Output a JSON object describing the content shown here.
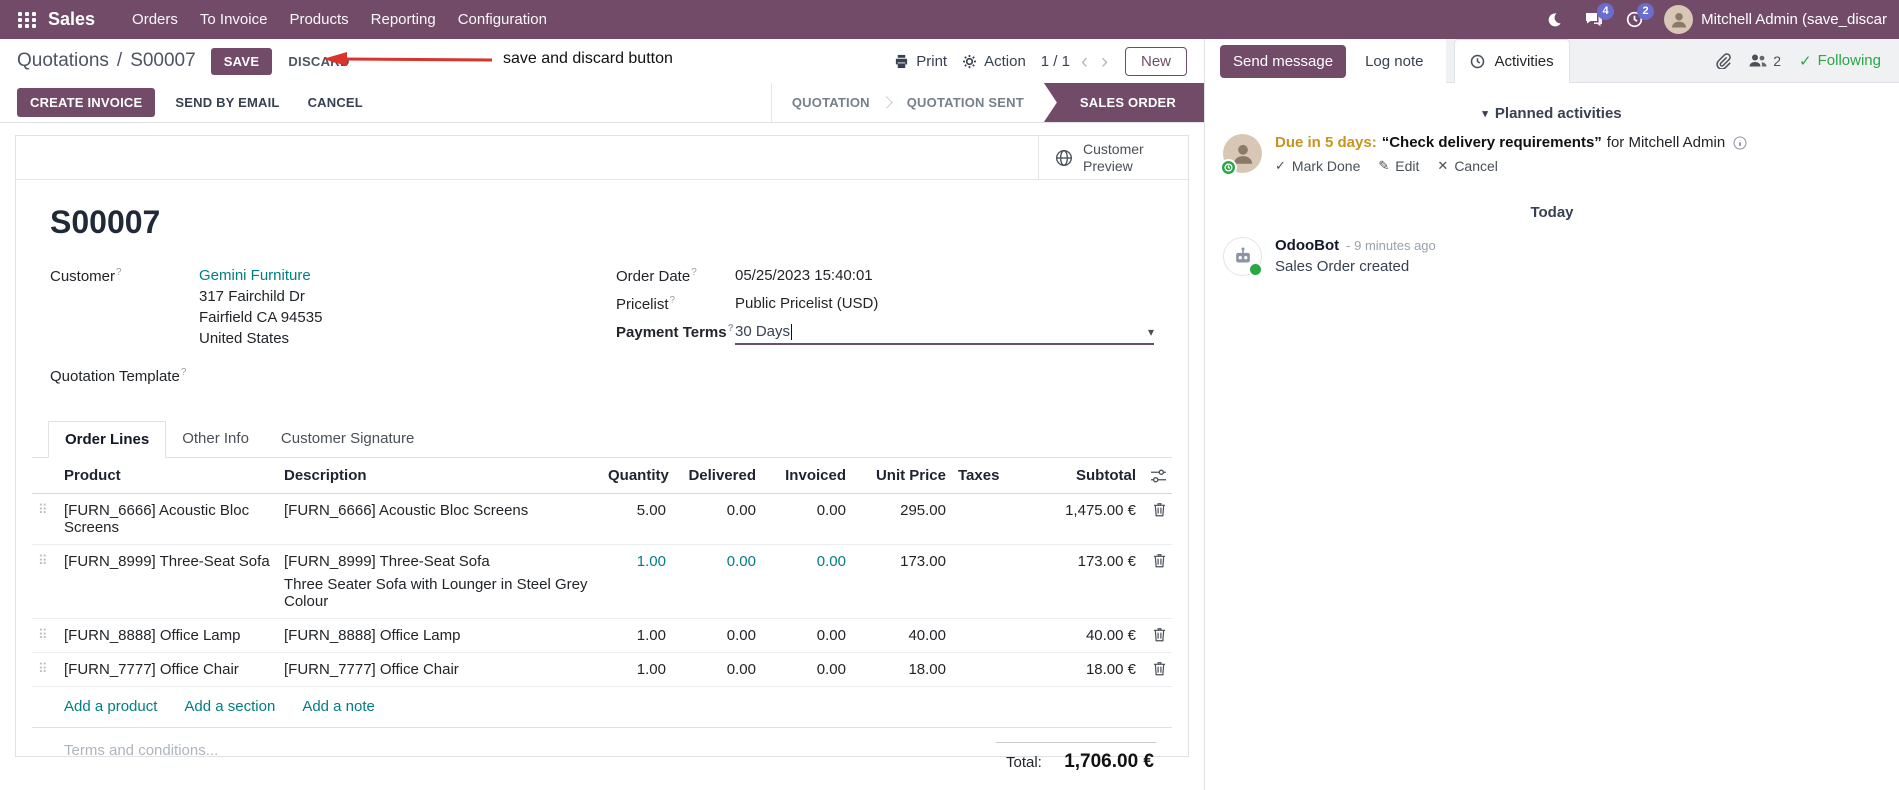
{
  "colors": {
    "primary": "#714B67",
    "link": "#017E84",
    "badge": "#6A6DCD",
    "annotation_arrow": "#D9342B",
    "activity_due": "#C7941F",
    "following_green": "#28a745"
  },
  "icons": {
    "help": "?",
    "drag_handle": "⠿",
    "dropdown_caret": "▾",
    "collapse_caret": "▾",
    "chevron_prev": "‹",
    "chevron_next": "›",
    "check": "✓",
    "pencil": "✎",
    "cross": "✕",
    "breadcrumb_sep": "/"
  },
  "nav": {
    "app": "Sales",
    "menus": [
      "Orders",
      "To Invoice",
      "Products",
      "Reporting",
      "Configuration"
    ],
    "badges": {
      "messages": "4",
      "activities": "2"
    },
    "user": "Mitchell Admin (save_discar"
  },
  "control": {
    "breadcrumb_parent": "Quotations",
    "breadcrumb_current": "S00007",
    "save": "SAVE",
    "discard": "DISCARD",
    "annotation": "save and discard button",
    "print": "Print",
    "action": "Action",
    "pager": "1 / 1",
    "new": "New"
  },
  "statusbar": {
    "create_invoice": "CREATE INVOICE",
    "send_by_email": "SEND BY EMAIL",
    "cancel": "CANCEL",
    "stages": [
      {
        "label": "QUOTATION",
        "active": false
      },
      {
        "label": "QUOTATION SENT",
        "active": false
      },
      {
        "label": "SALES ORDER",
        "active": true
      }
    ]
  },
  "sheet": {
    "customer_preview": "Customer Preview",
    "title": "S00007",
    "fields": {
      "customer_label": "Customer",
      "customer_value": "Gemini Furniture",
      "customer_address": [
        "317 Fairchild Dr",
        "Fairfield CA 94535",
        "United States"
      ],
      "quotation_template_label": "Quotation Template",
      "order_date_label": "Order Date",
      "order_date_value": "05/25/2023 15:40:01",
      "pricelist_label": "Pricelist",
      "pricelist_value": "Public Pricelist (USD)",
      "payment_terms_label": "Payment Terms",
      "payment_terms_value": "30 Days"
    },
    "tabs": [
      "Order Lines",
      "Other Info",
      "Customer Signature"
    ],
    "table": {
      "headers": [
        "Product",
        "Description",
        "Quantity",
        "Delivered",
        "Invoiced",
        "Unit Price",
        "Taxes",
        "Subtotal"
      ],
      "rows": [
        {
          "product": "[FURN_6666] Acoustic Bloc Screens",
          "description": "[FURN_6666] Acoustic Bloc Screens",
          "description2": "",
          "quantity": "5.00",
          "delivered": "0.00",
          "invoiced": "0.00",
          "unit_price": "295.00",
          "taxes": "",
          "subtotal": "1,475.00 €"
        },
        {
          "product": "[FURN_8999] Three-Seat Sofa",
          "description": "[FURN_8999] Three-Seat Sofa",
          "description2": "Three Seater Sofa with Lounger in Steel Grey Colour",
          "quantity": "1.00",
          "delivered": "0.00",
          "invoiced": "0.00",
          "unit_price": "173.00",
          "taxes": "",
          "subtotal": "173.00 €"
        },
        {
          "product": "[FURN_8888] Office Lamp",
          "description": "[FURN_8888] Office Lamp",
          "description2": "",
          "quantity": "1.00",
          "delivered": "0.00",
          "invoiced": "0.00",
          "unit_price": "40.00",
          "taxes": "",
          "subtotal": "40.00 €"
        },
        {
          "product": "[FURN_7777] Office Chair",
          "description": "[FURN_7777] Office Chair",
          "description2": "",
          "quantity": "1.00",
          "delivered": "0.00",
          "invoiced": "0.00",
          "unit_price": "18.00",
          "taxes": "",
          "subtotal": "18.00 €"
        }
      ],
      "add_product": "Add a product",
      "add_section": "Add a section",
      "add_note": "Add a note"
    },
    "terms_placeholder": "Terms and conditions...",
    "total_label": "Total:",
    "total_value": "1,706.00 €"
  },
  "chatter": {
    "send_message": "Send message",
    "log_note": "Log note",
    "activities_tab": "Activities",
    "followers_count": "2",
    "following": "Following",
    "planned_header": "Planned activities",
    "activity": {
      "due": "Due in 5 days:",
      "summary": "“Check delivery requirements”",
      "for_text": "for Mitchell Admin",
      "mark_done": "Mark Done",
      "edit": "Edit",
      "cancel": "Cancel"
    },
    "today": "Today",
    "message": {
      "author": "OdooBot",
      "time": "- 9 minutes ago",
      "body": "Sales Order created"
    }
  }
}
